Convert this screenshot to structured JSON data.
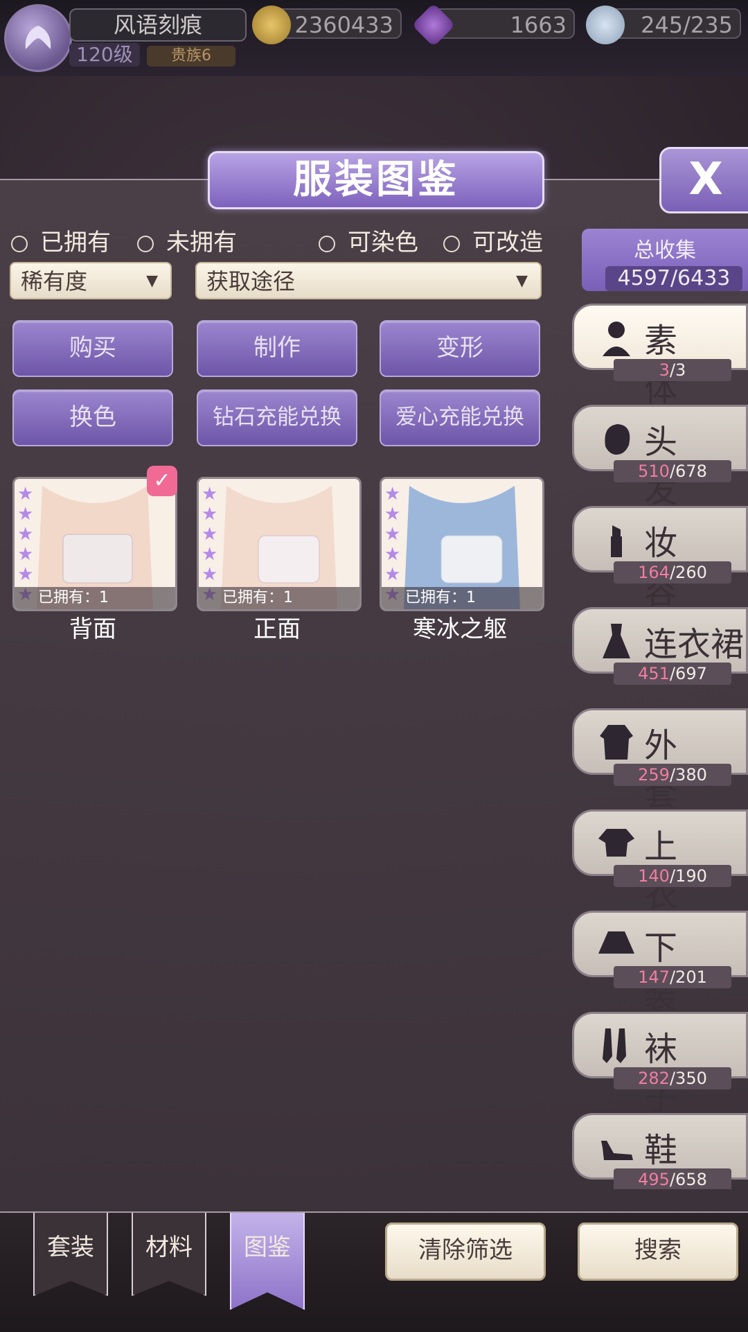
{
  "player": {
    "name": "风语刻痕",
    "level": "120级",
    "rank": "贵族6"
  },
  "resources": {
    "gold": "2360433",
    "diamond": "1663",
    "stamina": "245/235"
  },
  "panel": {
    "title": "服装图鉴",
    "close_label": "X"
  },
  "filters": {
    "owned": "已拥有",
    "not_owned": "未拥有",
    "dyeable": "可染色",
    "modifiable": "可改造",
    "rarity_dropdown": "稀有度",
    "source_dropdown": "获取途径"
  },
  "source_buttons": [
    "购买",
    "制作",
    "变形",
    "换色",
    "钻石充能兑换",
    "爱心充能兑换"
  ],
  "items": [
    {
      "name": "背面",
      "owned_text": "已拥有：1",
      "stars": 6,
      "selected": true
    },
    {
      "name": "正面",
      "owned_text": "已拥有：1",
      "stars": 6,
      "selected": false
    },
    {
      "name": "寒冰之躯",
      "owned_text": "已拥有：1",
      "stars": 6,
      "selected": false
    }
  ],
  "total": {
    "label": "总收集",
    "value": "4597/6433"
  },
  "categories": [
    {
      "label": "素体",
      "current": "3",
      "total": "3",
      "icon": "body-icon",
      "active": true
    },
    {
      "label": "头发",
      "current": "510",
      "total": "678",
      "icon": "hair-icon",
      "active": false
    },
    {
      "label": "妆容",
      "current": "164",
      "total": "260",
      "icon": "lipstick-icon",
      "active": false
    },
    {
      "label": "连衣裙",
      "current": "451",
      "total": "697",
      "icon": "dress-icon",
      "active": false
    },
    {
      "label": "外套",
      "current": "259",
      "total": "380",
      "icon": "coat-icon",
      "active": false
    },
    {
      "label": "上衣",
      "current": "140",
      "total": "190",
      "icon": "top-icon",
      "active": false
    },
    {
      "label": "下装",
      "current": "147",
      "total": "201",
      "icon": "skirt-icon",
      "active": false
    },
    {
      "label": "袜子",
      "current": "282",
      "total": "350",
      "icon": "socks-icon",
      "active": false
    },
    {
      "label": "鞋子",
      "current": "495",
      "total": "658",
      "icon": "shoe-icon",
      "active": false
    }
  ],
  "bottom": {
    "tabs": [
      "套装",
      "材料",
      "图鉴"
    ],
    "clear_filter": "清除筛选",
    "search": "搜索"
  },
  "colors": {
    "accent": "#8a70c6",
    "count_highlight": "#f07ea0",
    "panel": "#463a43"
  }
}
